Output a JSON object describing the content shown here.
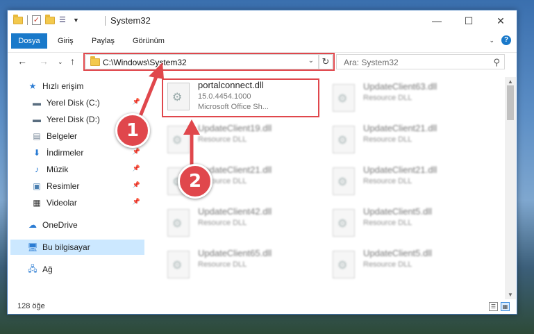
{
  "window": {
    "title": "System32"
  },
  "ribbon": {
    "tabs": [
      "Dosya",
      "Giriş",
      "Paylaş",
      "Görünüm"
    ]
  },
  "address": {
    "path": "C:\\Windows\\System32",
    "search_placeholder": "Ara: System32"
  },
  "nav": {
    "items": [
      {
        "label": "Hızlı erişim",
        "icon": "star-icon"
      },
      {
        "label": "Yerel Disk (C:)",
        "icon": "drive-icon"
      },
      {
        "label": "Yerel Disk (D:)",
        "icon": "drive-icon"
      },
      {
        "label": "Belgeler",
        "icon": "documents-icon"
      },
      {
        "label": "İndirmeler",
        "icon": "download-icon"
      },
      {
        "label": "Müzik",
        "icon": "music-icon"
      },
      {
        "label": "Resimler",
        "icon": "pictures-icon"
      },
      {
        "label": "Videolar",
        "icon": "video-icon"
      },
      {
        "label": "OneDrive",
        "icon": "cloud-icon"
      },
      {
        "label": "Bu bilgisayar",
        "icon": "computer-icon"
      },
      {
        "label": "Ağ",
        "icon": "network-icon"
      }
    ]
  },
  "files": [
    {
      "name": "portalconnect.dll",
      "line2": "15.0.4454.1000",
      "line3": "Microsoft Office Sh..."
    },
    {
      "name": "UpdateClient63.dll",
      "line2": "Resource DLL"
    },
    {
      "name": "UpdateClient19.dll",
      "line2": "Resource DLL"
    },
    {
      "name": "UpdateClient21.dll",
      "line2": "Resource DLL"
    },
    {
      "name": "UpdateClient21.dll",
      "line2": "Resource DLL"
    },
    {
      "name": "UpdateClient21.dll",
      "line2": "Resource DLL"
    },
    {
      "name": "UpdateClient42.dll",
      "line2": "Resource DLL"
    },
    {
      "name": "UpdateClient5.dll",
      "line2": "Resource DLL"
    },
    {
      "name": "UpdateClient65.dll",
      "line2": "Resource DLL"
    },
    {
      "name": "UpdateClient5.dll",
      "line2": "Resource DLL"
    }
  ],
  "status": {
    "item_count": "128 öğe"
  },
  "callouts": [
    "1",
    "2"
  ],
  "colors": {
    "accent": "#1979ca",
    "highlight": "#e0474c",
    "selected": "#cce8ff"
  }
}
